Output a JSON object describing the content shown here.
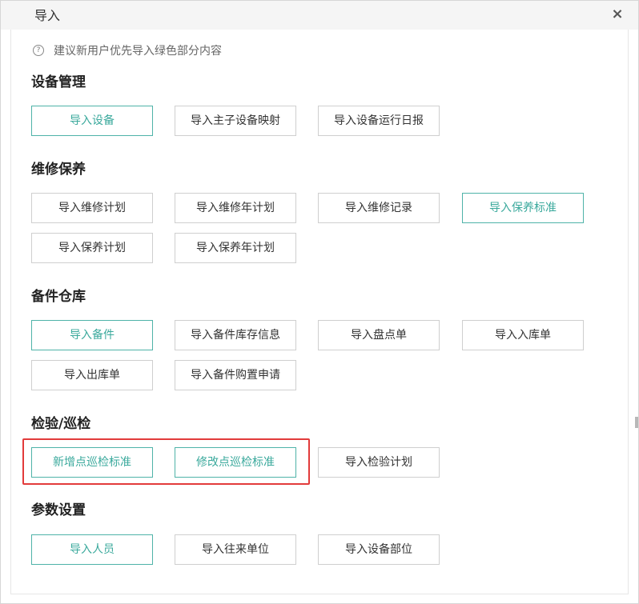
{
  "dialog": {
    "title": "导入",
    "close_glyph": "×"
  },
  "hint": {
    "icon_glyph": "?",
    "text": "建议新用户优先导入绿色部分内容"
  },
  "sections": [
    {
      "title": "设备管理",
      "buttons": [
        {
          "label": "导入设备",
          "recommended": true
        },
        {
          "label": "导入主子设备映射",
          "recommended": false
        },
        {
          "label": "导入设备运行日报",
          "recommended": false
        }
      ]
    },
    {
      "title": "维修保养",
      "buttons": [
        {
          "label": "导入维修计划",
          "recommended": false
        },
        {
          "label": "导入维修年计划",
          "recommended": false
        },
        {
          "label": "导入维修记录",
          "recommended": false
        },
        {
          "label": "导入保养标准",
          "recommended": true
        },
        {
          "label": "导入保养计划",
          "recommended": false
        },
        {
          "label": "导入保养年计划",
          "recommended": false
        }
      ]
    },
    {
      "title": "备件仓库",
      "buttons": [
        {
          "label": "导入备件",
          "recommended": true
        },
        {
          "label": "导入备件库存信息",
          "recommended": false
        },
        {
          "label": "导入盘点单",
          "recommended": false
        },
        {
          "label": "导入入库单",
          "recommended": false
        },
        {
          "label": "导入出库单",
          "recommended": false
        },
        {
          "label": "导入备件购置申请",
          "recommended": false
        }
      ]
    },
    {
      "title": "检验/巡检",
      "buttons": [
        {
          "label": "新增点巡检标准",
          "recommended": true
        },
        {
          "label": "修改点巡检标准",
          "recommended": true
        },
        {
          "label": "导入检验计划",
          "recommended": false
        }
      ]
    },
    {
      "title": "参数设置",
      "buttons": [
        {
          "label": "导入人员",
          "recommended": true
        },
        {
          "label": "导入往来单位",
          "recommended": false
        },
        {
          "label": "导入设备部位",
          "recommended": false
        }
      ]
    }
  ],
  "colors": {
    "accent": "#4fb3a8",
    "highlight": "#e23b3b"
  }
}
